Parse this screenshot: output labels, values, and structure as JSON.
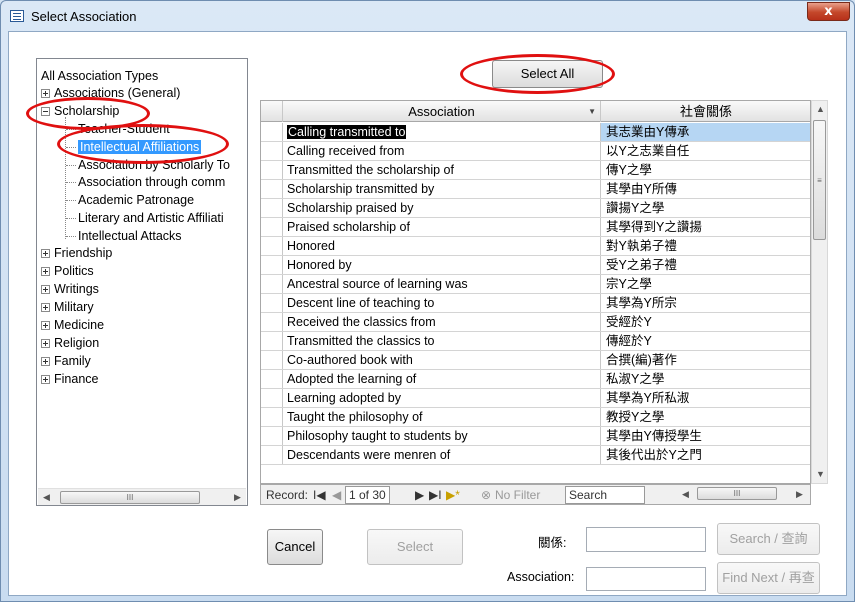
{
  "window": {
    "title": "Select Association",
    "close_label": "x"
  },
  "tree": {
    "root": "All Association Types",
    "nodes": [
      {
        "label": "Associations (General)",
        "expander": "plus"
      },
      {
        "label": "Scholarship",
        "expander": "minus"
      }
    ],
    "children": [
      "Teacher-Student",
      "Intellectual Affiliations",
      "Association by Scholarly To",
      "Association through comm",
      "Academic Patronage",
      "Literary and Artistic Affiliati",
      "Intellectual Attacks"
    ],
    "more_nodes": [
      "Friendship",
      "Politics",
      "Writings",
      "Military",
      "Medicine",
      "Religion",
      "Family",
      "Finance"
    ],
    "selected": "Intellectual Affiliations",
    "hscroll_thumb": "III"
  },
  "select_all_label": "Select All",
  "grid": {
    "headers": [
      "Association",
      "社會關係"
    ],
    "rows": [
      [
        "Calling transmitted to",
        "其志業由Y傳承"
      ],
      [
        "Calling received from",
        "以Y之志業自任"
      ],
      [
        "Transmitted the scholarship of",
        "傳Y之學"
      ],
      [
        "Scholarship transmitted by",
        "其學由Y所傳"
      ],
      [
        "Scholarship praised by",
        "讚揚Y之學"
      ],
      [
        "Praised scholarship of",
        "其學得到Y之讚揚"
      ],
      [
        "Honored",
        "對Y執弟子禮"
      ],
      [
        "Honored by",
        "受Y之弟子禮"
      ],
      [
        "Ancestral source of learning was",
        "宗Y之學"
      ],
      [
        "Descent line of teaching to",
        "其學為Y所宗"
      ],
      [
        "Received the classics from",
        "受經於Y"
      ],
      [
        "Transmitted the classics to",
        "傳經於Y"
      ],
      [
        "Co-authored book with",
        "合撰(編)著作"
      ],
      [
        "Adopted the learning of",
        "私淑Y之學"
      ],
      [
        "Learning adopted by",
        "其學為Y所私淑"
      ],
      [
        "Taught the philosophy of",
        "教授Y之學"
      ],
      [
        "Philosophy taught to students by",
        "其學由Y傳授學生"
      ],
      [
        "Descendants were menren of",
        "其後代出於Y之門"
      ]
    ]
  },
  "navbar": {
    "record_label": "Record:",
    "record_value": "1 of 30",
    "filter_label": "No Filter",
    "search_label": "Search"
  },
  "buttons": {
    "cancel": "Cancel",
    "select": "Select",
    "search": "Search / 查詢",
    "find_next": "Find Next / 再查"
  },
  "fields": {
    "relation_label": "關係:",
    "association_label": "Association:"
  },
  "annotation_color": "#e01010"
}
